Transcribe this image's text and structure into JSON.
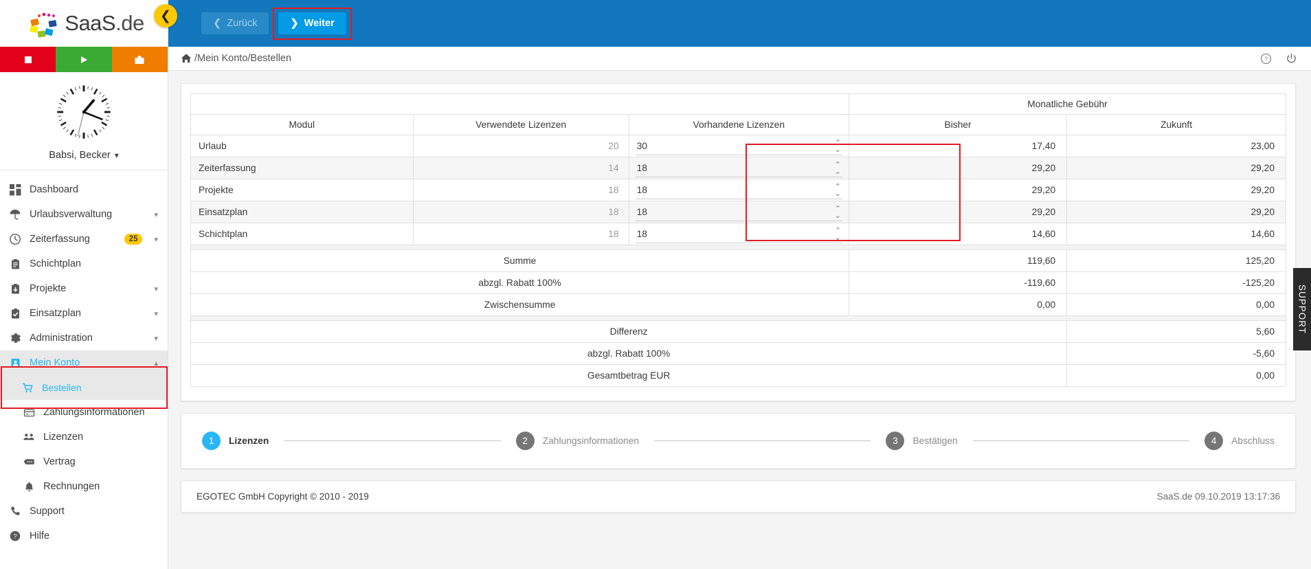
{
  "brand": {
    "name_main": "SaaS",
    "name_suffix": ".de",
    "logo_colors": [
      "#e94e1b",
      "#f7a600",
      "#ffed00",
      "#95c11f",
      "#009fe3",
      "#1d4f91",
      "#e6007e"
    ]
  },
  "quick_bar": [
    {
      "name": "stop-button",
      "icon": "square-icon",
      "color": "#e2001a"
    },
    {
      "name": "play-button",
      "icon": "play-icon",
      "color": "#3aaa35"
    },
    {
      "name": "briefcase-button",
      "icon": "briefcase-icon",
      "color": "#ef7d00"
    }
  ],
  "user": {
    "name": "Babsi, Becker"
  },
  "sidebar": {
    "items": [
      {
        "label": "Dashboard",
        "icon": "dashboard-icon",
        "chevron": false,
        "badge": null,
        "level": 0,
        "active": false
      },
      {
        "label": "Urlaubsverwaltung",
        "icon": "umbrella-icon",
        "chevron": true,
        "badge": null,
        "level": 0,
        "active": false
      },
      {
        "label": "Zeiterfassung",
        "icon": "clock-icon",
        "chevron": true,
        "badge": "25",
        "level": 0,
        "active": false
      },
      {
        "label": "Schichtplan",
        "icon": "clipboard-icon",
        "chevron": false,
        "badge": null,
        "level": 0,
        "active": false
      },
      {
        "label": "Projekte",
        "icon": "clipboard-down-icon",
        "chevron": true,
        "badge": null,
        "level": 0,
        "active": false
      },
      {
        "label": "Einsatzplan",
        "icon": "clipboard-check-icon",
        "chevron": true,
        "badge": null,
        "level": 0,
        "active": false
      },
      {
        "label": "Administration",
        "icon": "gear-icon",
        "chevron": true,
        "badge": null,
        "level": 0,
        "active": false
      },
      {
        "label": "Mein Konto",
        "icon": "user-card-icon",
        "chevron": true,
        "chevron_up": true,
        "badge": null,
        "level": 0,
        "active": true
      },
      {
        "label": "Bestellen",
        "icon": "cart-icon",
        "chevron": false,
        "badge": null,
        "level": 1,
        "active": true
      },
      {
        "label": "Zahlungsinformationen",
        "icon": "credit-card-icon",
        "chevron": false,
        "badge": null,
        "level": 1,
        "active": false
      },
      {
        "label": "Lizenzen",
        "icon": "users-icon",
        "chevron": false,
        "badge": null,
        "level": 1,
        "active": false
      },
      {
        "label": "Vertrag",
        "icon": "contract-icon",
        "chevron": false,
        "badge": null,
        "level": 1,
        "active": false
      },
      {
        "label": "Rechnungen",
        "icon": "bell-icon",
        "chevron": false,
        "badge": null,
        "level": 1,
        "active": false
      },
      {
        "label": "Support",
        "icon": "phone-icon",
        "chevron": false,
        "badge": null,
        "level": 0,
        "active": false
      },
      {
        "label": "Hilfe",
        "icon": "help-icon",
        "chevron": false,
        "badge": null,
        "level": 0,
        "active": false
      }
    ]
  },
  "topbar": {
    "back_label": "Zurück",
    "next_label": "Weiter",
    "collapse_icon": "chevron-left-icon",
    "accent": "#1277bc",
    "next_color": "#039be5",
    "highlight_color": "#e31b23"
  },
  "breadcrumb": {
    "home_icon": "home-icon",
    "path": "/Mein Konto/Bestellen",
    "help_icon": "question-circle-icon",
    "power_icon": "power-icon"
  },
  "table": {
    "group_header": "Monatliche Gebühr",
    "columns": [
      "Modul",
      "Verwendete Lizenzen",
      "Vorhandene Lizenzen",
      "Bisher",
      "Zukunft"
    ],
    "rows": [
      {
        "modul": "Urlaub",
        "verwendet": "20",
        "vorhanden": "30",
        "bisher": "17,40",
        "zukunft": "23,00"
      },
      {
        "modul": "Zeiterfassung",
        "verwendet": "14",
        "vorhanden": "18",
        "bisher": "29,20",
        "zukunft": "29,20"
      },
      {
        "modul": "Projekte",
        "verwendet": "18",
        "vorhanden": "18",
        "bisher": "29,20",
        "zukunft": "29,20"
      },
      {
        "modul": "Einsatzplan",
        "verwendet": "18",
        "vorhanden": "18",
        "bisher": "29,20",
        "zukunft": "29,20"
      },
      {
        "modul": "Schichtplan",
        "verwendet": "18",
        "vorhanden": "18",
        "bisher": "14,60",
        "zukunft": "14,60"
      }
    ],
    "summary": [
      {
        "label": "Summe",
        "bisher": "119,60",
        "zukunft": "125,20"
      },
      {
        "label": "abzgl. Rabatt 100%",
        "bisher": "-119,60",
        "zukunft": "-125,20"
      },
      {
        "label": "Zwischensumme",
        "bisher": "0,00",
        "zukunft": "0,00"
      }
    ],
    "totals": [
      {
        "label": "Differenz",
        "value": "5,60"
      },
      {
        "label": "abzgl. Rabatt 100%",
        "value": "-5,60"
      },
      {
        "label": "Gesamtbetrag EUR",
        "value": "0,00"
      }
    ]
  },
  "steps": [
    {
      "number": "1",
      "label": "Lizenzen",
      "current": true
    },
    {
      "number": "2",
      "label": "Zahlungsinformationen",
      "current": false
    },
    {
      "number": "3",
      "label": "Bestätigen",
      "current": false
    },
    {
      "number": "4",
      "label": "Abschluss",
      "current": false
    }
  ],
  "footer": {
    "copyright": "EGOTEC GmbH Copyright © 2010 - 2019",
    "right": "SaaS.de  09.10.2019 13:17:36"
  },
  "support_tab": {
    "label": "SUPPORT"
  }
}
